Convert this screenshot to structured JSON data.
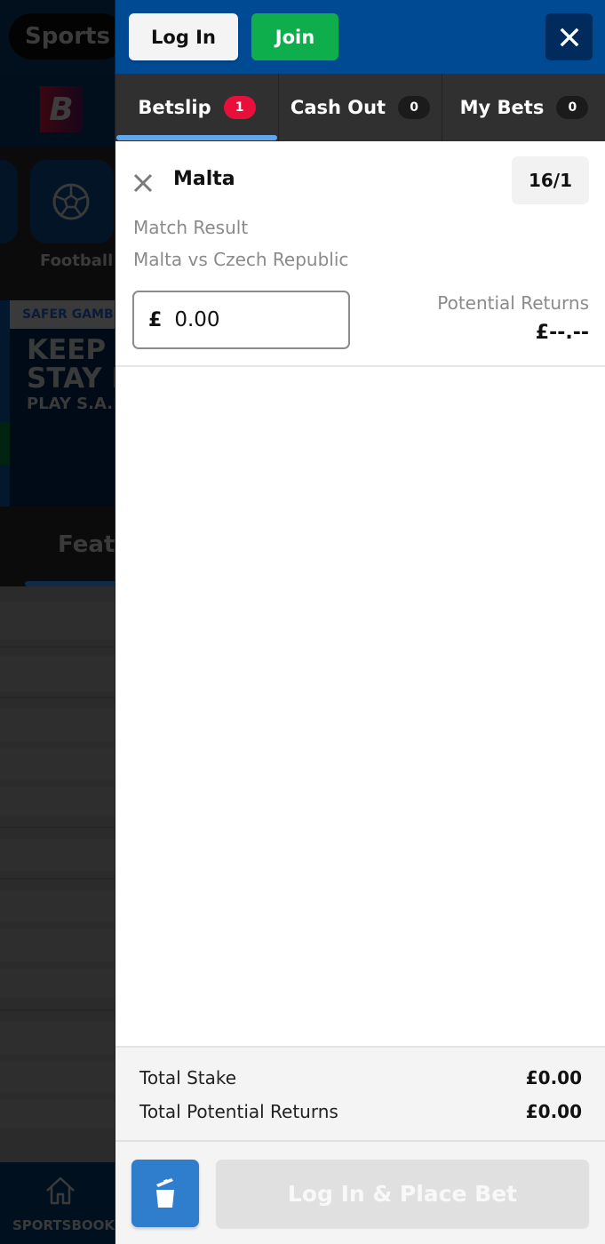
{
  "background": {
    "sports_pill": "Sports",
    "logo_letter": "B",
    "category": {
      "label": "Football",
      "icon": "football-icon"
    },
    "banner": {
      "tag": "SAFER GAMBLING",
      "line1": "KEEP IT FUN",
      "line2": "STAY IN CONTROL",
      "line3": "PLAY S.A.F.E."
    },
    "featured_label": "Featured",
    "bottom_nav": {
      "label": "SPORTSBOOK",
      "icon": "home-icon"
    }
  },
  "header": {
    "login_label": "Log In",
    "join_label": "Join",
    "close_icon": "close-icon"
  },
  "tabs": [
    {
      "label": "Betslip",
      "count": "1",
      "active": true,
      "badge_color": "#e8103a"
    },
    {
      "label": "Cash Out",
      "count": "0",
      "active": false
    },
    {
      "label": "My Bets",
      "count": "0",
      "active": false
    }
  ],
  "selection": {
    "name": "Malta",
    "odds": "16/1",
    "market": "Match Result",
    "event": "Malta vs Czech Republic",
    "currency": "£",
    "stake_value": "0.00",
    "potential_returns_label": "Potential Returns",
    "potential_returns_value": "£--.--"
  },
  "totals": {
    "stake_label": "Total Stake",
    "stake_value": "£0.00",
    "returns_label": "Total Potential Returns",
    "returns_value": "£0.00"
  },
  "footer": {
    "trash_icon": "trash-icon",
    "place_bet_label": "Log In & Place Bet"
  },
  "colors": {
    "header_blue": "#004a94",
    "join_green": "#0fae4c",
    "tab_indicator": "#5ea7f0",
    "badge_red": "#e8103a",
    "trash_blue": "#2f7dcd"
  }
}
